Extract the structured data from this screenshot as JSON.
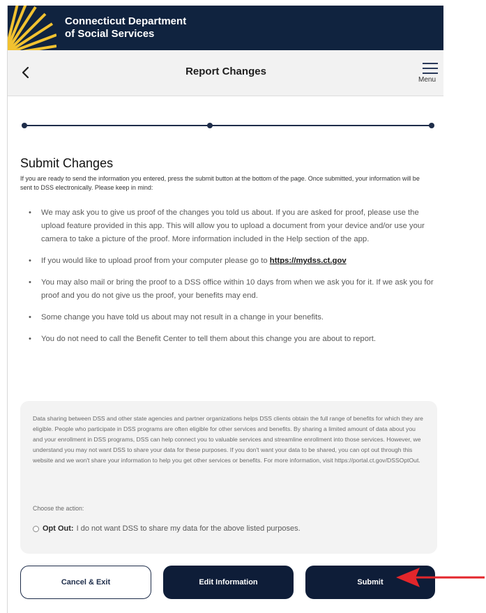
{
  "header": {
    "agency_name": "Connecticut Department\nof Social Services"
  },
  "nav": {
    "title": "Report Changes",
    "menu_label": "Menu"
  },
  "content": {
    "section_title": "Submit Changes",
    "intro": "If you are ready to send the information you entered, press the submit button at the bottom of the page. Once submitted, your information will be sent to DSS electronically. Please keep in mind:",
    "bullets": [
      "We may ask you to give us proof of the changes you told us about. If you are asked for proof, please use the upload feature provided in this app. This will allow you to upload a document from your device and/or use your camera to take a picture of the proof. More information included in the Help section of the app.",
      "If you would like to upload proof from your computer please go to",
      "You may also mail or bring the proof to a DSS office within 10 days from when we ask you for it. If we ask you for proof and you do not give us the proof, your benefits may end.",
      "Some change you have told us about may not result in a change in your benefits.",
      "You do not need to call the Benefit Center to tell them about this change you are about to report."
    ],
    "link": "https://mydss.ct.gov"
  },
  "data_sharing": {
    "text": "Data sharing between DSS and other state agencies and partner organizations helps DSS clients obtain the full range of benefits for which they are eligible. People who participate in DSS programs are often eligible for other services and benefits. By sharing a limited amount of data about you and your enrollment in DSS programs, DSS can help connect you to valuable services and streamline enrollment into those services. However, we understand you may not want DSS to share your data for these purposes. If you don't want your data to be shared, you can opt out through this website and we won't share your information to help you get other services or benefits. For more information, visit https://portal.ct.gov/DSSOptOut.",
    "choose_label": "Choose the action:",
    "optout_label": "Opt Out:",
    "optout_text": "I do not want DSS to share my data for the above listed purposes."
  },
  "buttons": {
    "cancel": "Cancel & Exit",
    "edit": "Edit Information",
    "submit": "Submit"
  },
  "colors": {
    "header_bg": "#10233f",
    "button_dark": "#0e1d38",
    "arrow": "#e3262b",
    "sunburst": "#f2c230"
  },
  "icons": {
    "back": "chevron-left-icon",
    "menu": "hamburger-icon",
    "logo": "sunburst-logo",
    "annotation": "red-arrow-icon"
  }
}
